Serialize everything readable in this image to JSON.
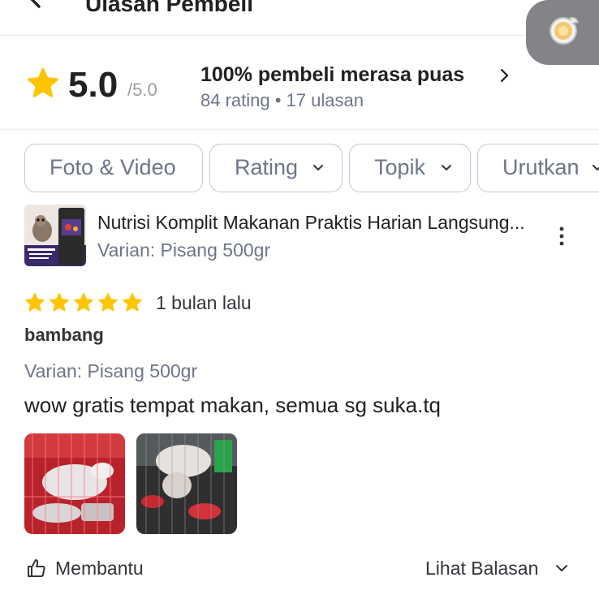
{
  "header": {
    "title": "Ulasan Pembeli",
    "back_icon": "arrow-left-icon",
    "floating_icon": "lightbulb-icon"
  },
  "summary": {
    "score": "5.0",
    "score_max": "/5.0",
    "satisfied": "100% pembeli merasa puas",
    "counts": "84 rating • 17 ulasan",
    "star_color": "#FFC400"
  },
  "filters": [
    {
      "label": "Foto & Video",
      "has_dropdown": false
    },
    {
      "label": "Rating",
      "has_dropdown": true
    },
    {
      "label": "Topik",
      "has_dropdown": true
    },
    {
      "label": "Urutkan",
      "has_dropdown": true
    }
  ],
  "product": {
    "name": "Nutrisi Komplit Makanan Praktis Harian Langsung...",
    "variant": "Varian: Pisang 500gr"
  },
  "review": {
    "rating": 5,
    "time_ago": "1 bulan lalu",
    "reviewer": "bambang",
    "variant": "Varian: Pisang 500gr",
    "text": "wow gratis tempat makan, semua sg suka.tq",
    "photo_count": 2
  },
  "actions": {
    "helpful": "Membantu",
    "view_replies": "Lihat Balasan"
  },
  "colors": {
    "accent_star": "#FFC400",
    "muted_text": "#6D7588",
    "chip_border": "#BFC9D9"
  }
}
